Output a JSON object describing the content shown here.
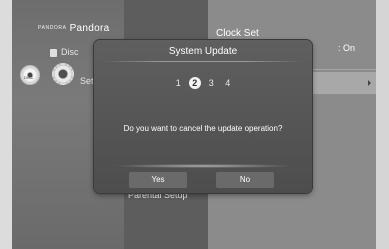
{
  "left_menu": {
    "logo_small": "PANDORA",
    "logo": "Pandora",
    "disc_label": "Disc",
    "settings_label": "Set",
    "disc_icon_text": "DISC"
  },
  "middle": {
    "parental_setup": "Parental Setup"
  },
  "right_panel": {
    "clock_set": "Clock Set",
    "clock_value": ": On"
  },
  "dialog": {
    "title": "System Update",
    "steps": [
      "1",
      "2",
      "3",
      "4"
    ],
    "active_step": 2,
    "message": "Do you want to cancel the update operation?",
    "yes_label": "Yes",
    "no_label": "No"
  }
}
